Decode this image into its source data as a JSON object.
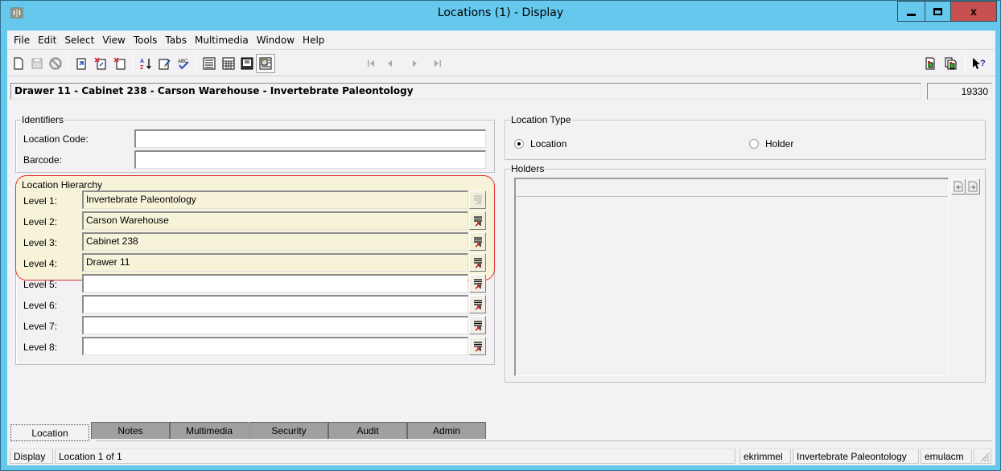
{
  "window": {
    "title": "Locations (1) - Display",
    "controls": {
      "minimize": "minimize",
      "maximize": "maximize",
      "close": "x"
    }
  },
  "menu": [
    "File",
    "Edit",
    "Select",
    "View",
    "Tools",
    "Tabs",
    "Multimedia",
    "Window",
    "Help"
  ],
  "toolbar": {
    "icons": [
      "new-document-icon",
      "save-icon",
      "cancel-icon",
      "open-record-icon",
      "delete-record-icon",
      "discard-icon",
      "sort-az-icon",
      "notes-edit-icon",
      "spell-check-icon",
      "details-view-icon",
      "list-view-icon",
      "page-view-icon",
      "image-view-icon",
      "first-record-icon",
      "previous-record-icon",
      "next-record-icon",
      "last-record-icon",
      "copy-record-icon",
      "copy-records-icon",
      "context-help-icon"
    ]
  },
  "record": {
    "summary": "Drawer 11 - Cabinet 238 - Carson Warehouse - Invertebrate Paleontology",
    "irn": "19330"
  },
  "identifiers": {
    "legend": "Identifiers",
    "location_code_label": "Location Code:",
    "location_code_value": "",
    "barcode_label": "Barcode:",
    "barcode_value": ""
  },
  "hierarchy": {
    "legend": "Location Hierarchy",
    "levels": [
      {
        "label": "Level 1:",
        "value": "Invertebrate Paleontology"
      },
      {
        "label": "Level 2:",
        "value": "Carson Warehouse"
      },
      {
        "label": "Level 3:",
        "value": "Cabinet 238"
      },
      {
        "label": "Level 4:",
        "value": "Drawer 11"
      },
      {
        "label": "Level 5:",
        "value": ""
      },
      {
        "label": "Level 6:",
        "value": ""
      },
      {
        "label": "Level 7:",
        "value": ""
      },
      {
        "label": "Level 8:",
        "value": ""
      }
    ]
  },
  "location_type": {
    "legend": "Location Type",
    "options": [
      {
        "label": "Location",
        "selected": true
      },
      {
        "label": "Holder",
        "selected": false
      }
    ]
  },
  "holders": {
    "legend": "Holders"
  },
  "tabs": [
    "Location",
    "Notes",
    "Multimedia",
    "Security",
    "Audit",
    "Admin"
  ],
  "active_tab": "Location",
  "status": {
    "mode": "Display",
    "position": "Location 1 of 1",
    "user": "ekrimmel",
    "department": "Invertebrate Paleontology",
    "database": "emulacm"
  },
  "colors": {
    "title_bar": "#65c8ec",
    "close_button": "#c75050",
    "highlight_border": "#e03030",
    "highlight_fill": "#f6f3d9"
  }
}
